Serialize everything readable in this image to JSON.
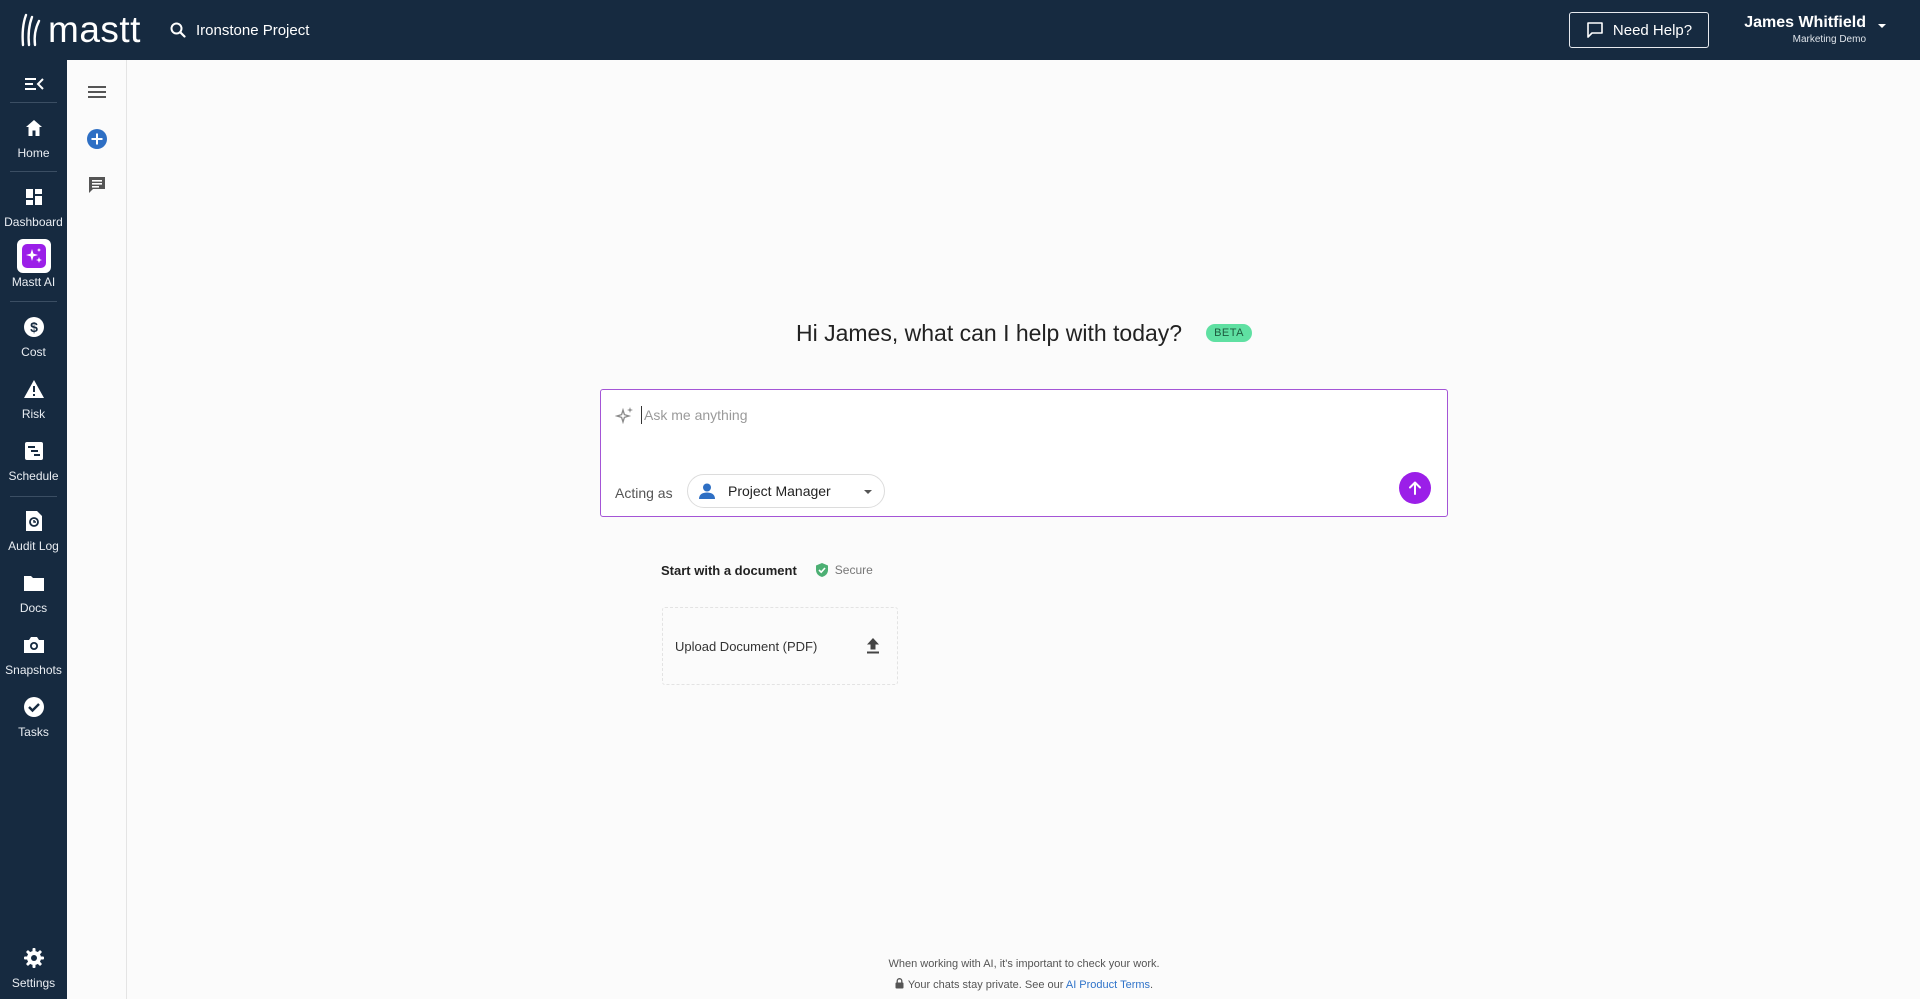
{
  "header": {
    "logo_text": "mastt",
    "project_name": "Ironstone Project",
    "help_label": "Need Help?",
    "user_name": "James Whitfield",
    "user_org": "Marketing Demo"
  },
  "sidebar": {
    "items": [
      {
        "label": "Home",
        "icon": "home-icon"
      },
      {
        "label": "Dashboard",
        "icon": "dashboard-icon"
      },
      {
        "label": "Mastt AI",
        "icon": "sparkle-icon",
        "active": true
      },
      {
        "label": "Cost",
        "icon": "dollar-icon"
      },
      {
        "label": "Risk",
        "icon": "warning-icon"
      },
      {
        "label": "Schedule",
        "icon": "schedule-icon"
      },
      {
        "label": "Audit Log",
        "icon": "audit-log-icon"
      },
      {
        "label": "Docs",
        "icon": "folder-icon"
      },
      {
        "label": "Snapshots",
        "icon": "camera-icon"
      },
      {
        "label": "Tasks",
        "icon": "check-circle-icon"
      }
    ],
    "settings_label": "Settings"
  },
  "main": {
    "greeting": "Hi James, what can I help with today?",
    "beta_label": "BETA",
    "ask_placeholder": "Ask me anything",
    "ask_value": "",
    "acting_as_label": "Acting as",
    "role_selected": "Project Manager",
    "doc_heading": "Start with a document",
    "secure_label": "Secure",
    "upload_label": "Upload Document (PDF)"
  },
  "footer": {
    "line1": "When working with AI, it's important to check your work.",
    "line2_prefix": "Your chats stay private. See our",
    "terms_link": "AI Product Terms",
    "line2_suffix": "."
  },
  "colors": {
    "nav_bg": "#162a40",
    "accent_purple": "#9b1fe8",
    "beta_green": "#5fe0a2",
    "link_blue": "#2f73c9"
  }
}
